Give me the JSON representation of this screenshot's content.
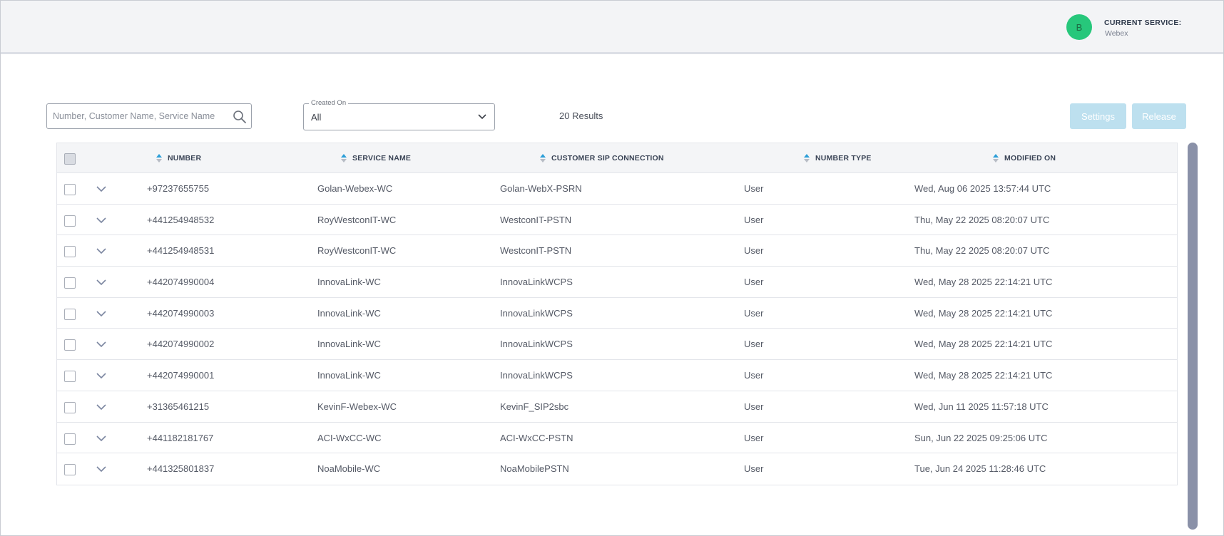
{
  "header": {
    "avatar_initial": "B",
    "current_service_label": "CURRENT SERVICE:",
    "current_service_value": "Webex"
  },
  "toolbar": {
    "search_placeholder": "Number, Customer Name, Service Name",
    "search_value": "",
    "created_on_label": "Created On",
    "created_on_value": "All",
    "results_text": "20 Results",
    "settings_label": "Settings",
    "release_label": "Release"
  },
  "table": {
    "columns": [
      "NUMBER",
      "SERVICE NAME",
      "CUSTOMER SIP CONNECTION",
      "NUMBER TYPE",
      "MODIFIED ON"
    ],
    "rows": [
      {
        "number": "+97237655755",
        "service": "Golan-Webex-WC",
        "sip": "Golan-WebX-PSRN",
        "type": "User",
        "modified": "Wed, Aug 06 2025 13:57:44 UTC"
      },
      {
        "number": "+441254948532",
        "service": "RoyWestconIT-WC",
        "sip": "WestconIT-PSTN",
        "type": "User",
        "modified": "Thu, May 22 2025 08:20:07 UTC"
      },
      {
        "number": "+441254948531",
        "service": "RoyWestconIT-WC",
        "sip": "WestconIT-PSTN",
        "type": "User",
        "modified": "Thu, May 22 2025 08:20:07 UTC"
      },
      {
        "number": "+442074990004",
        "service": "InnovaLink-WC",
        "sip": "InnovaLinkWCPS",
        "type": "User",
        "modified": "Wed, May 28 2025 22:14:21 UTC"
      },
      {
        "number": "+442074990003",
        "service": "InnovaLink-WC",
        "sip": "InnovaLinkWCPS",
        "type": "User",
        "modified": "Wed, May 28 2025 22:14:21 UTC"
      },
      {
        "number": "+442074990002",
        "service": "InnovaLink-WC",
        "sip": "InnovaLinkWCPS",
        "type": "User",
        "modified": "Wed, May 28 2025 22:14:21 UTC"
      },
      {
        "number": "+442074990001",
        "service": "InnovaLink-WC",
        "sip": "InnovaLinkWCPS",
        "type": "User",
        "modified": "Wed, May 28 2025 22:14:21 UTC"
      },
      {
        "number": "+31365461215",
        "service": "KevinF-Webex-WC",
        "sip": "KevinF_SIP2sbc",
        "type": "User",
        "modified": "Wed, Jun 11 2025 11:57:18 UTC"
      },
      {
        "number": "+441182181767",
        "service": "ACI-WxCC-WC",
        "sip": "ACI-WxCC-PSTN",
        "type": "User",
        "modified": "Sun, Jun 22 2025 09:25:06 UTC"
      },
      {
        "number": "+441325801837",
        "service": "NoaMobile-WC",
        "sip": "NoaMobilePSTN",
        "type": "User",
        "modified": "Tue, Jun 24 2025 11:28:46 UTC"
      }
    ]
  },
  "colors": {
    "avatar": "#27c77b",
    "button_disabled": "#bde0ef",
    "sort_active": "#2a9ed8",
    "scrollbar": "#8a91a8"
  },
  "icons": [
    "search-icon",
    "chevron-down-icon",
    "sort-icon",
    "expand-chevron-icon"
  ]
}
